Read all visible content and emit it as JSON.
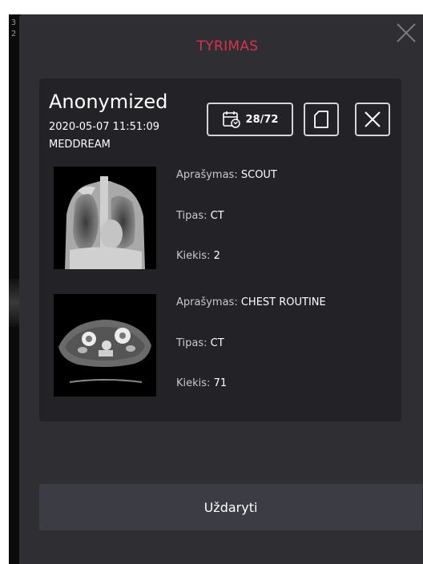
{
  "viewer": {
    "overlay_lines": [
      "3",
      "2"
    ]
  },
  "dialog": {
    "title": "TYRIMAS",
    "close_icon": "close-icon",
    "accent_color": "#d8324f"
  },
  "study": {
    "patient_name": "Anonymized",
    "datetime": "2020-05-07 11:51:09",
    "source": "MEDDREAM",
    "series_button": {
      "icon": "calendar-refresh-icon",
      "label": "28/72"
    },
    "copy_button": {
      "icon": "document-icon"
    },
    "remove_button": {
      "icon": "close-icon"
    },
    "series": [
      {
        "thumbnail": "chest-xray-scout-thumbnail",
        "description_label": "Aprašymas:",
        "description": "SCOUT",
        "type_label": "Tipas:",
        "type": "CT",
        "count_label": "Kiekis:",
        "count": "2"
      },
      {
        "thumbnail": "chest-ct-axial-thumbnail",
        "description_label": "Aprašymas:",
        "description": "CHEST ROUTINE",
        "type_label": "Tipas:",
        "type": "CT",
        "count_label": "Kiekis:",
        "count": "71"
      }
    ]
  },
  "footer": {
    "close_label": "Uždaryti"
  }
}
